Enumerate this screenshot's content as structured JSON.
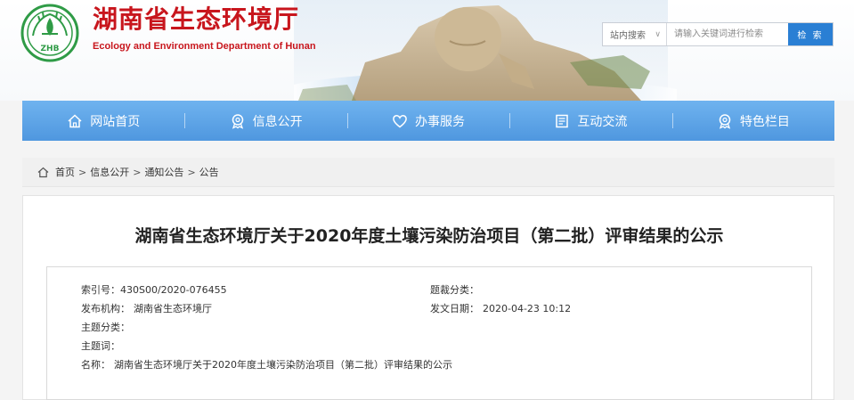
{
  "header": {
    "logo_text": "ZHB",
    "title": "湖南省生态环境厅",
    "subtitle": "Ecology and Environment Department of Hunan"
  },
  "search": {
    "scope": "站内搜索",
    "placeholder": "请输入关键词进行检索",
    "button": "检 索"
  },
  "nav": [
    {
      "label": "网站首页",
      "icon": "home-icon"
    },
    {
      "label": "信息公开",
      "icon": "badge-icon"
    },
    {
      "label": "办事服务",
      "icon": "heart-icon"
    },
    {
      "label": "互动交流",
      "icon": "document-icon"
    },
    {
      "label": "特色栏目",
      "icon": "badge-icon"
    }
  ],
  "breadcrumb": [
    "首页",
    "信息公开",
    "通知公告",
    "公告"
  ],
  "article": {
    "title": "湖南省生态环境厅关于2020年度土壤污染防治项目（第二批）评审结果的公示"
  },
  "meta": {
    "index_key": "索引号：",
    "index_value": "430S00/2020-076455",
    "genre_key": "题裁分类：",
    "genre_value": "",
    "publisher_key": "发布机构：",
    "publisher_value": "湖南省生态环境厅",
    "date_key": "发文日期：",
    "date_value": "2020-04-23 10:12",
    "topic_key": "主题分类：",
    "topic_value": "",
    "keywords_key": "主题词：",
    "keywords_value": "",
    "name_key": "名称：",
    "name_value": "湖南省生态环境厅关于2020年度土壤污染防治项目（第二批）评审结果的公示"
  },
  "colors": {
    "brand_red": "#c8161d",
    "nav_blue": "#5ea5e8",
    "search_button": "#2a7fd4",
    "logo_green": "#2f9b46"
  }
}
